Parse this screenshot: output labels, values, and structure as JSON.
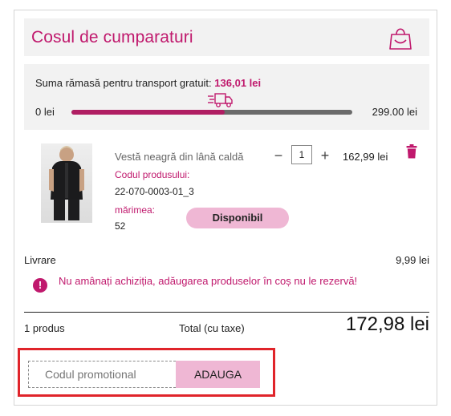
{
  "cart": {
    "title": "Cosul de cumparaturi",
    "icon": "shopping-bag-icon"
  },
  "shipping": {
    "message": "Suma rămasă pentru transport gratuit:",
    "remaining": "136,01 lei",
    "min_label": "0 lei",
    "max_label": "299.00 lei",
    "progress_fraction": 0.545,
    "icon": "delivery-truck-icon"
  },
  "item": {
    "name": "Vestă neagră din lână caldă",
    "quantity": "1",
    "price": "162,99 lei",
    "code_label": "Codul produsului:",
    "code_value": "22-070-0003-01_3",
    "size_label": "mărimea:",
    "size_value": "52",
    "status": "Disponibil"
  },
  "delivery": {
    "label": "Livrare",
    "value": "9,99 lei"
  },
  "warning": {
    "text": "Nu amânați achiziția, adăugarea produselor în coș nu le rezervă!"
  },
  "summary": {
    "count": "1 produs",
    "total_label": "Total (cu taxe)",
    "total_value": "172,98 lei"
  },
  "promo": {
    "placeholder": "Codul promotional",
    "button": "ADAUGA"
  },
  "colors": {
    "accent": "#c0196d",
    "pill": "#efb7d4",
    "highlight_border": "#e0242a"
  }
}
